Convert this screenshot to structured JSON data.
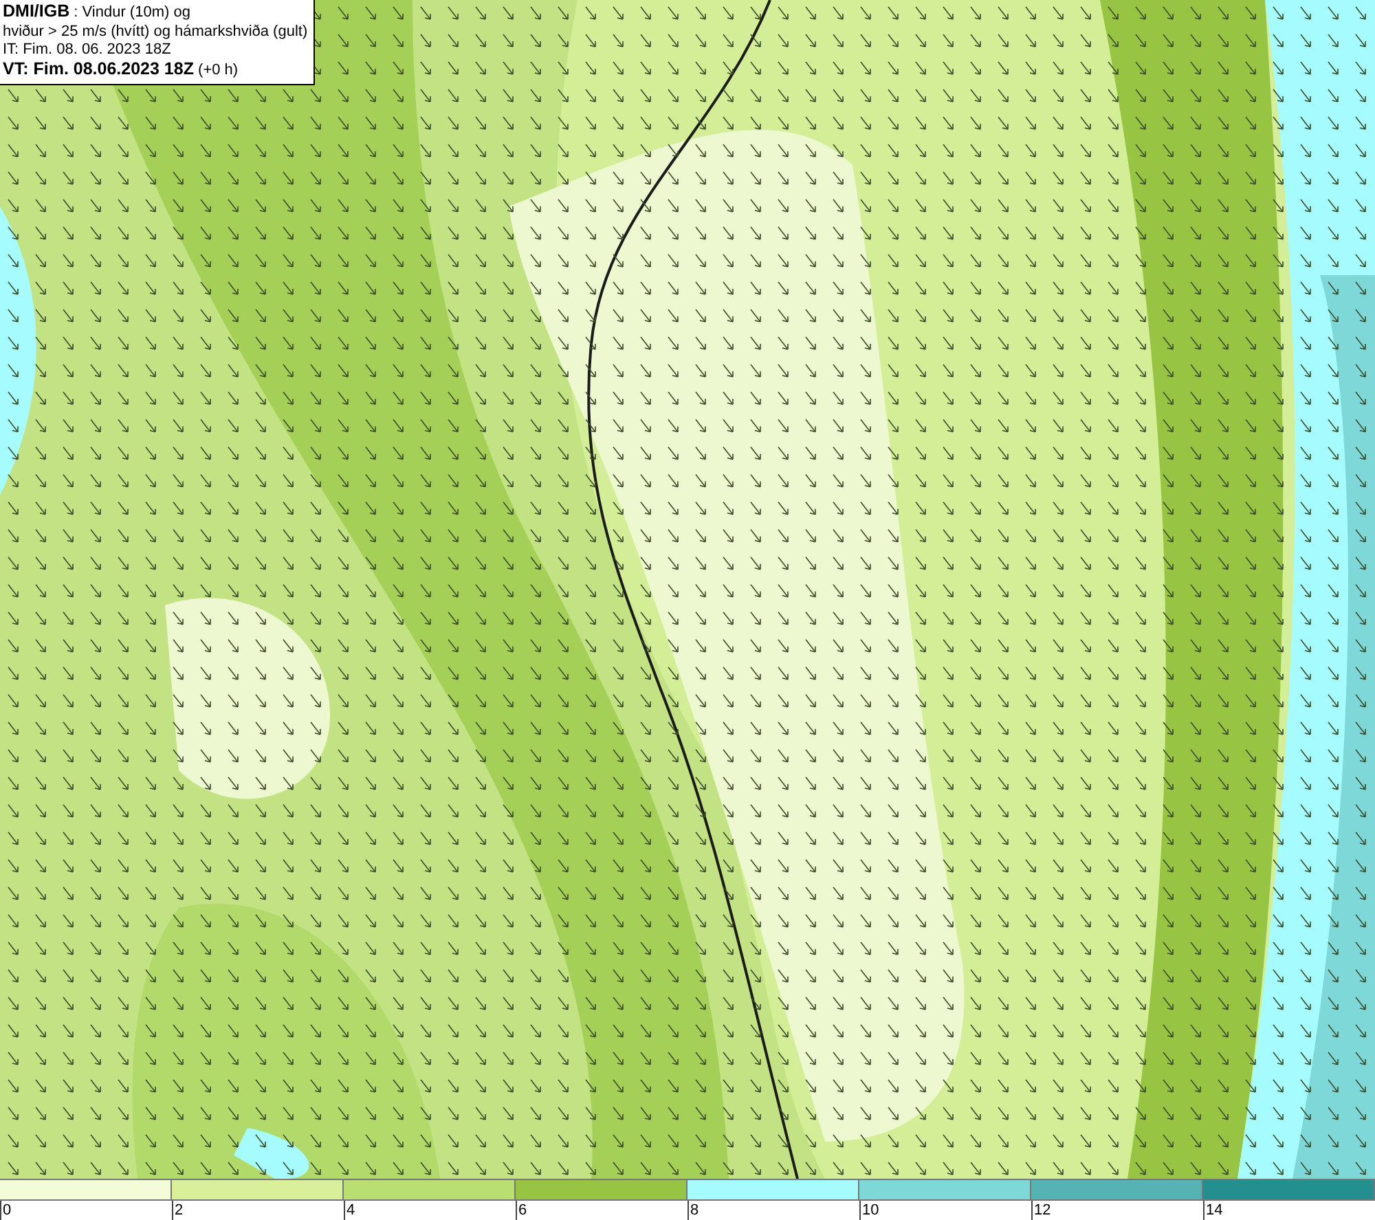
{
  "title_box": {
    "lines": [
      "**DMI/IGB** : Vindur (10m) og",
      "hviður > 25 m/s (hvítt) og hámarkshviða (gult)",
      "IT: Fim. 08. 06. 2023 18Z",
      "**VT: Fim. 08.06.2023 18Z** (+0 h)"
    ]
  },
  "legend": {
    "bins": [
      {
        "color": "#f4fbd9",
        "label": "0"
      },
      {
        "color": "#d8f09a",
        "label": "2"
      },
      {
        "color": "#b9df73",
        "label": "4"
      },
      {
        "color": "#98c444",
        "label": "6"
      },
      {
        "color": "#a6fbff",
        "label": "8"
      },
      {
        "color": "#7fd8d8",
        "label": "10"
      },
      {
        "color": "#55b3b3",
        "label": "12"
      },
      {
        "color": "#248f8f",
        "label": "14"
      }
    ]
  }
}
